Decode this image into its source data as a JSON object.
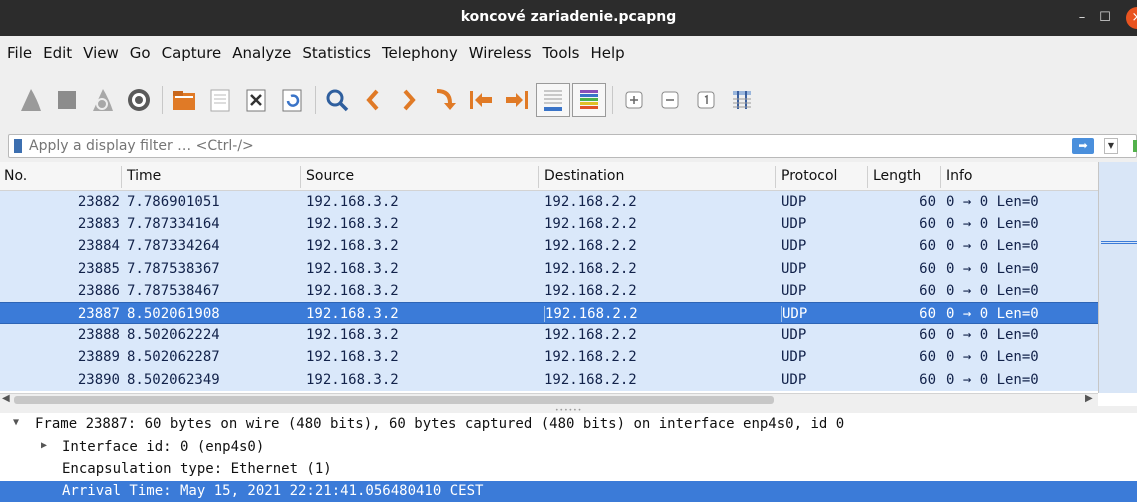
{
  "window": {
    "title": "koncové zariadenie.pcapng"
  },
  "menu": [
    "File",
    "Edit",
    "View",
    "Go",
    "Capture",
    "Analyze",
    "Statistics",
    "Telephony",
    "Wireless",
    "Tools",
    "Help"
  ],
  "toolbar_icons": [
    "shark-fin-start-icon",
    "stop-square-icon",
    "shark-fin-restart-icon",
    "gear-options-icon",
    "open-folder-icon",
    "save-file-icon",
    "close-file-icon",
    "reload-icon",
    "search-icon",
    "back-arrow-icon",
    "forward-arrow-icon",
    "go-to-packet-icon",
    "first-packet-icon",
    "last-packet-icon",
    "autoscroll-icon",
    "colorize-icon",
    "zoom-in-icon",
    "zoom-out-icon",
    "normal-size-icon",
    "resize-columns-icon"
  ],
  "filter": {
    "placeholder": "Apply a display filter … <Ctrl-/>"
  },
  "packet_list": {
    "columns": {
      "no": "No.",
      "time": "Time",
      "source": "Source",
      "destination": "Destination",
      "protocol": "Protocol",
      "length": "Length",
      "info": "Info"
    },
    "rows": [
      {
        "no": "23882",
        "time": "7.786901051",
        "src": "192.168.3.2",
        "dst": "192.168.2.2",
        "proto": "UDP",
        "len": "60",
        "info": "0 → 0 Len=0"
      },
      {
        "no": "23883",
        "time": "7.787334164",
        "src": "192.168.3.2",
        "dst": "192.168.2.2",
        "proto": "UDP",
        "len": "60",
        "info": "0 → 0 Len=0"
      },
      {
        "no": "23884",
        "time": "7.787334264",
        "src": "192.168.3.2",
        "dst": "192.168.2.2",
        "proto": "UDP",
        "len": "60",
        "info": "0 → 0 Len=0"
      },
      {
        "no": "23885",
        "time": "7.787538367",
        "src": "192.168.3.2",
        "dst": "192.168.2.2",
        "proto": "UDP",
        "len": "60",
        "info": "0 → 0 Len=0"
      },
      {
        "no": "23886",
        "time": "7.787538467",
        "src": "192.168.3.2",
        "dst": "192.168.2.2",
        "proto": "UDP",
        "len": "60",
        "info": "0 → 0 Len=0"
      },
      {
        "no": "23887",
        "time": "8.502061908",
        "src": "192.168.3.2",
        "dst": "192.168.2.2",
        "proto": "UDP",
        "len": "60",
        "info": "0 → 0 Len=0"
      },
      {
        "no": "23888",
        "time": "8.502062224",
        "src": "192.168.3.2",
        "dst": "192.168.2.2",
        "proto": "UDP",
        "len": "60",
        "info": "0 → 0 Len=0"
      },
      {
        "no": "23889",
        "time": "8.502062287",
        "src": "192.168.3.2",
        "dst": "192.168.2.2",
        "proto": "UDP",
        "len": "60",
        "info": "0 → 0 Len=0"
      },
      {
        "no": "23890",
        "time": "8.502062349",
        "src": "192.168.3.2",
        "dst": "192.168.2.2",
        "proto": "UDP",
        "len": "60",
        "info": "0 → 0 Len=0"
      }
    ]
  },
  "details": {
    "frame": "Frame 23887: 60 bytes on wire (480 bits), 60 bytes captured (480 bits) on interface enp4s0, id 0",
    "interface": "Interface id: 0 (enp4s0)",
    "encapsulation": "Encapsulation type: Ethernet (1)",
    "arrival": "Arrival Time: May 15, 2021 22:21:41.056480410 CEST"
  },
  "colors": {
    "row_bg": "#dae8fa",
    "selected": "#3b7bd8",
    "titlebar": "#2c2c2c",
    "close": "#e95420"
  }
}
